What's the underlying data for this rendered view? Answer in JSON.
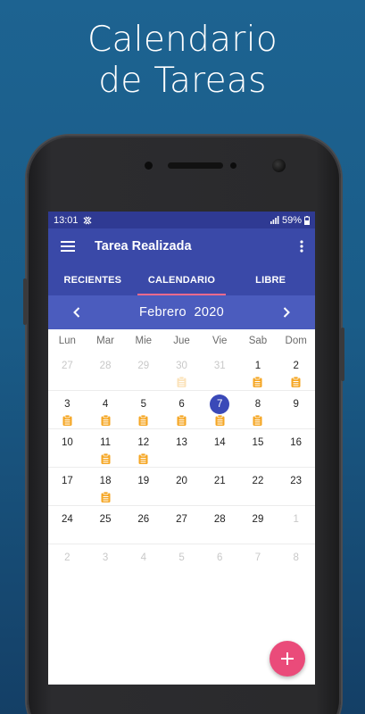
{
  "promo": {
    "line1": "Calendario",
    "line2": "de Tareas"
  },
  "status_bar": {
    "time": "13:01",
    "battery": "59%"
  },
  "app_bar": {
    "title": "Tarea Realizada"
  },
  "tabs": [
    {
      "label": "RECIENTES",
      "active": false
    },
    {
      "label": "CALENDARIO",
      "active": true
    },
    {
      "label": "LIBRE",
      "active": false
    }
  ],
  "calendar": {
    "month": "Febrero",
    "year": "2020",
    "weekdays": [
      "Lun",
      "Mar",
      "Mie",
      "Jue",
      "Vie",
      "Sab",
      "Dom"
    ],
    "weeks": [
      [
        {
          "d": "27",
          "muted": true,
          "task": false
        },
        {
          "d": "28",
          "muted": true,
          "task": false
        },
        {
          "d": "29",
          "muted": true,
          "task": false
        },
        {
          "d": "30",
          "muted": true,
          "task": true
        },
        {
          "d": "31",
          "muted": true,
          "task": false
        },
        {
          "d": "1",
          "muted": false,
          "task": true
        },
        {
          "d": "2",
          "muted": false,
          "task": true
        }
      ],
      [
        {
          "d": "3",
          "muted": false,
          "task": true
        },
        {
          "d": "4",
          "muted": false,
          "task": true
        },
        {
          "d": "5",
          "muted": false,
          "task": true
        },
        {
          "d": "6",
          "muted": false,
          "task": true
        },
        {
          "d": "7",
          "muted": false,
          "task": true,
          "selected": true
        },
        {
          "d": "8",
          "muted": false,
          "task": true
        },
        {
          "d": "9",
          "muted": false,
          "task": false
        }
      ],
      [
        {
          "d": "10",
          "muted": false,
          "task": false
        },
        {
          "d": "11",
          "muted": false,
          "task": true
        },
        {
          "d": "12",
          "muted": false,
          "task": true
        },
        {
          "d": "13",
          "muted": false,
          "task": false
        },
        {
          "d": "14",
          "muted": false,
          "task": false
        },
        {
          "d": "15",
          "muted": false,
          "task": false
        },
        {
          "d": "16",
          "muted": false,
          "task": false
        }
      ],
      [
        {
          "d": "17",
          "muted": false,
          "task": false
        },
        {
          "d": "18",
          "muted": false,
          "task": true
        },
        {
          "d": "19",
          "muted": false,
          "task": false
        },
        {
          "d": "20",
          "muted": false,
          "task": false
        },
        {
          "d": "21",
          "muted": false,
          "task": false
        },
        {
          "d": "22",
          "muted": false,
          "task": false
        },
        {
          "d": "23",
          "muted": false,
          "task": false
        }
      ],
      [
        {
          "d": "24",
          "muted": false,
          "task": false
        },
        {
          "d": "25",
          "muted": false,
          "task": false
        },
        {
          "d": "26",
          "muted": false,
          "task": false
        },
        {
          "d": "27",
          "muted": false,
          "task": false
        },
        {
          "d": "28",
          "muted": false,
          "task": false
        },
        {
          "d": "29",
          "muted": false,
          "task": false
        },
        {
          "d": "1",
          "muted": true,
          "task": false
        }
      ],
      [
        {
          "d": "2",
          "muted": true,
          "task": false
        },
        {
          "d": "3",
          "muted": true,
          "task": false
        },
        {
          "d": "4",
          "muted": true,
          "task": false
        },
        {
          "d": "5",
          "muted": true,
          "task": false
        },
        {
          "d": "6",
          "muted": true,
          "task": false
        },
        {
          "d": "7",
          "muted": true,
          "task": false
        },
        {
          "d": "8",
          "muted": true,
          "task": false
        }
      ]
    ]
  },
  "fab": {
    "icon": "plus-icon"
  },
  "colors": {
    "primary": "#3a49a8",
    "month_bar": "#4b5cbe",
    "tab_indicator": "#f06a8d",
    "accent": "#ea4b7a",
    "task_icon": "#f5a623",
    "selected_day": "#3a49b8"
  }
}
